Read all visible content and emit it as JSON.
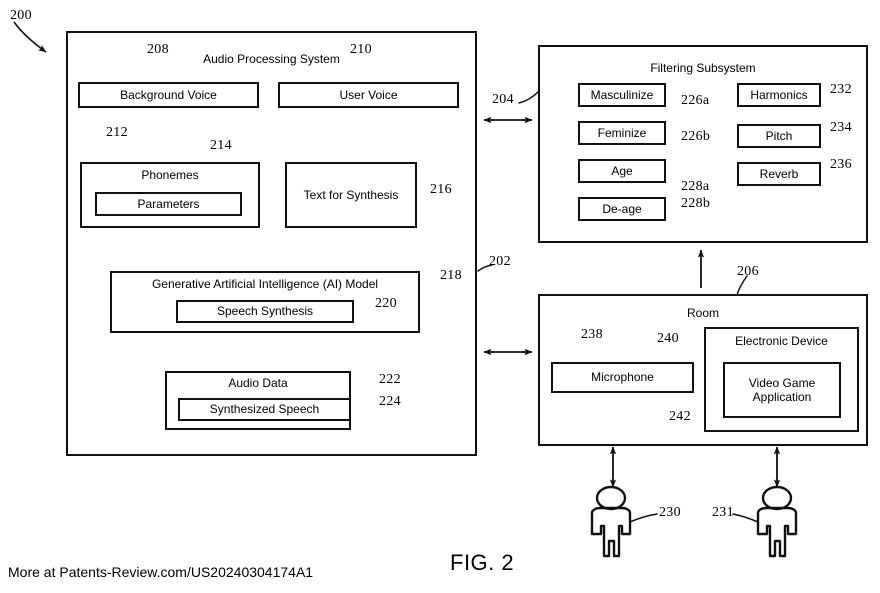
{
  "figure": {
    "caption": "FIG. 2",
    "footer_note": "More at Patents-Review.com/US20240304174A1",
    "root_ref": "200"
  },
  "panels": {
    "audio_processing_system": {
      "title": "Audio Processing System",
      "ref": "202",
      "boxes": {
        "background_voice": {
          "label": "Background Voice",
          "ref": "208"
        },
        "user_voice": {
          "label": "User Voice",
          "ref": "210"
        },
        "phonemes": {
          "label": "Phonemes",
          "ref": "212"
        },
        "parameters": {
          "label": "Parameters",
          "ref": "214"
        },
        "text_for_synthesis": {
          "label": "Text for Synthesis",
          "ref": "216"
        },
        "ai_model": {
          "label": "Generative Artificial Intelligence (AI) Model",
          "ref": "218"
        },
        "speech_synthesis": {
          "label": "Speech Synthesis",
          "ref": "220"
        },
        "audio_data": {
          "label": "Audio Data",
          "ref": "222"
        },
        "synthesized_speech": {
          "label": "Synthesized Speech",
          "ref": "224"
        }
      }
    },
    "filtering_subsystem": {
      "title": "Filtering Subsystem",
      "ref": "204",
      "boxes": {
        "masculinize": {
          "label": "Masculinize",
          "ref": "226a"
        },
        "feminize": {
          "label": "Feminize",
          "ref": "226b"
        },
        "age": {
          "label": "Age",
          "ref": "228a"
        },
        "de_age": {
          "label": "De-age",
          "ref": "228b"
        },
        "harmonics": {
          "label": "Harmonics",
          "ref": "232"
        },
        "pitch": {
          "label": "Pitch",
          "ref": "234"
        },
        "reverb": {
          "label": "Reverb",
          "ref": "236"
        }
      }
    },
    "room": {
      "title": "Room",
      "ref": "206",
      "boxes": {
        "microphone": {
          "label": "Microphone",
          "ref": "238"
        },
        "electronic_device": {
          "label": "Electronic Device",
          "ref": "240"
        },
        "video_game_application": {
          "label": "Video Game Application",
          "ref": "242"
        }
      }
    }
  },
  "people": {
    "person_left": {
      "ref": "230"
    },
    "person_right": {
      "ref": "231"
    }
  },
  "colors": {
    "stroke": "#111111",
    "background": "#ffffff"
  }
}
